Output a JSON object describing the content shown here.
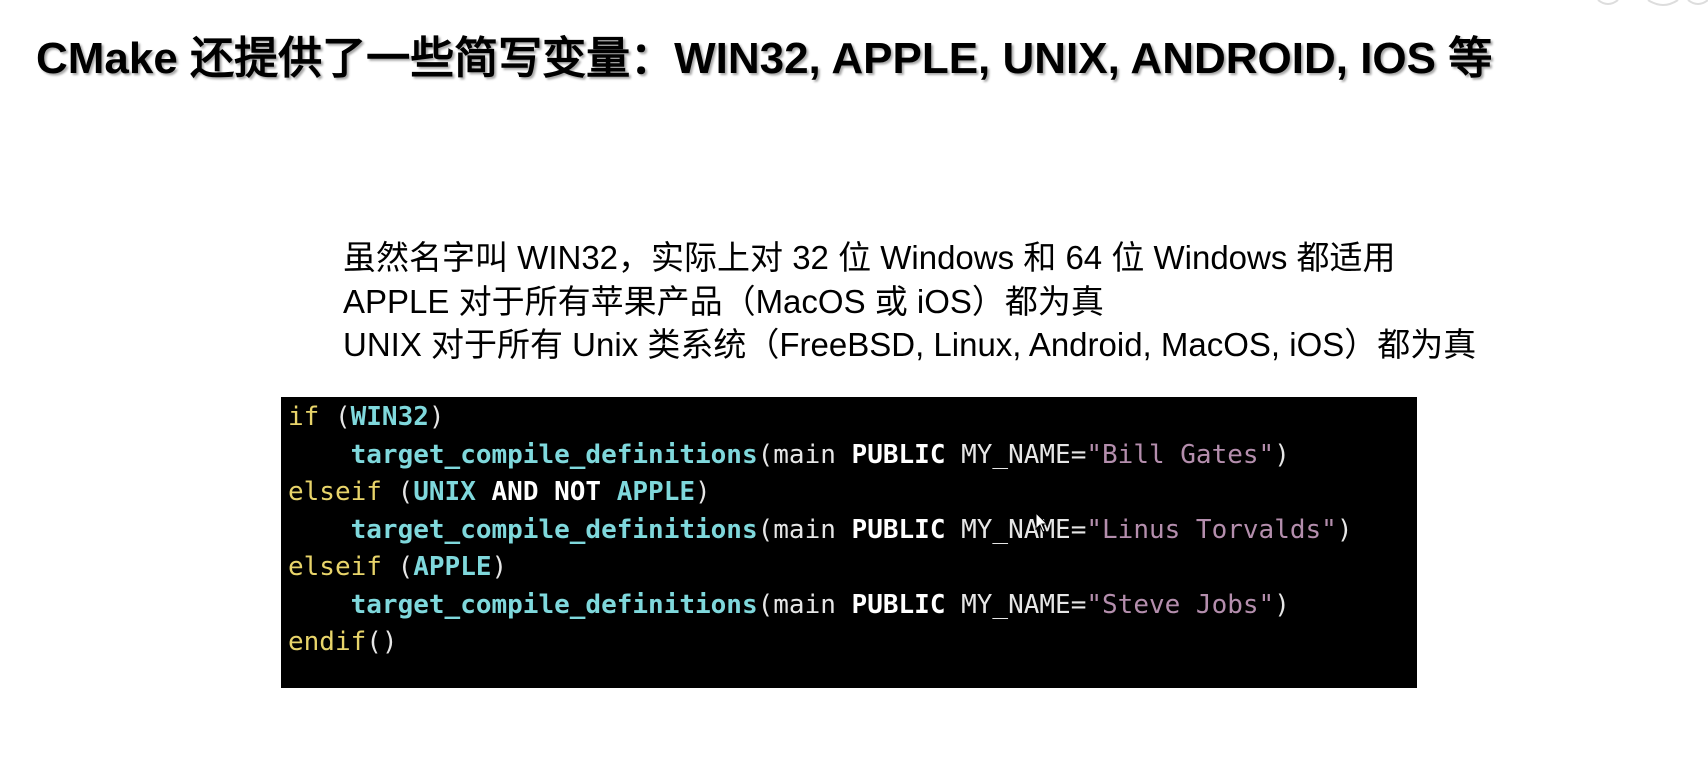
{
  "slide": {
    "title": "CMake 还提供了一些简写变量：WIN32, APPLE, UNIX, ANDROID, IOS 等",
    "notes": [
      "虽然名字叫 WIN32，实际上对 32 位 Windows 和 64 位 Windows 都适用",
      "APPLE 对于所有苹果产品（MacOS 或 iOS）都为真",
      "UNIX 对于所有 Unix 类系统（FreeBSD, Linux, Android, MacOS, iOS）都为真"
    ]
  },
  "code": {
    "line1": {
      "kw": "if",
      "sp": " (",
      "cond": "WIN32",
      "close": ")"
    },
    "line2": {
      "indent": "    ",
      "fn": "target_compile_definitions",
      "open": "(main ",
      "vis": "PUBLIC",
      "def": " MY_NAME=",
      "str": "\"Bill Gates\"",
      "close": ")"
    },
    "line3": {
      "kw": "elseif",
      "sp": " (",
      "a": "UNIX",
      "and": " AND NOT ",
      "b": "APPLE",
      "close": ")"
    },
    "line4": {
      "indent": "    ",
      "fn": "target_compile_definitions",
      "open": "(main ",
      "vis": "PUBLIC",
      "def": " MY_NAME=",
      "str": "\"Linus Torvalds\"",
      "close": ")"
    },
    "line5": {
      "kw": "elseif",
      "sp": " (",
      "cond": "APPLE",
      "close": ")"
    },
    "line6": {
      "indent": "    ",
      "fn": "target_compile_definitions",
      "open": "(main ",
      "vis": "PUBLIC",
      "def": " MY_NAME=",
      "str": "\"Steve Jobs\"",
      "close": ")"
    },
    "line7": {
      "kw": "endif",
      "rest": "()"
    }
  },
  "colors": {
    "background": "#ffffff",
    "code_background": "#000000",
    "keyword": "#e8d46a",
    "identifier": "#7fd8dc",
    "string": "#b48ead",
    "plain": "#e6e6e6"
  },
  "icons": {
    "mouse_cursor": "mouse-cursor-icon"
  }
}
